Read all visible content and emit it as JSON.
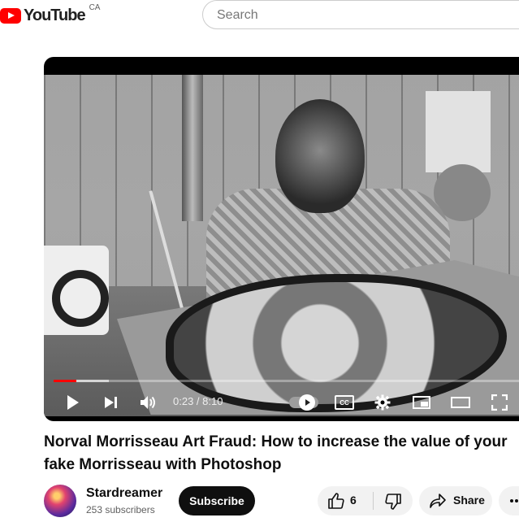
{
  "header": {
    "logo_text": "YouTube",
    "country_code": "CA",
    "search_placeholder": "Search"
  },
  "player": {
    "time_display": "0:23 / 8:10",
    "progress_fraction": 0.047,
    "buffered_fraction": 0.115,
    "cc_label": "CC"
  },
  "video": {
    "title": "Norval Morrisseau Art Fraud: How to increase the value of your fake Morrisseau with Photoshop"
  },
  "channel": {
    "name": "Stardreamer",
    "subscribers": "253 subscribers",
    "subscribe_label": "Subscribe"
  },
  "actions": {
    "like_count": "6",
    "share_label": "Share"
  },
  "colors": {
    "brand_red": "#ff0000",
    "progress_red": "#ff0000",
    "button_dark": "#0f0f0f",
    "pill_bg": "#f2f2f2"
  },
  "icons": [
    "play-icon",
    "next-icon",
    "volume-icon",
    "autoplay-toggle",
    "captions-icon",
    "settings-icon",
    "miniplayer-icon",
    "theater-icon",
    "fullscreen-icon",
    "thumbs-up-icon",
    "thumbs-down-icon",
    "share-icon",
    "more-icon"
  ]
}
